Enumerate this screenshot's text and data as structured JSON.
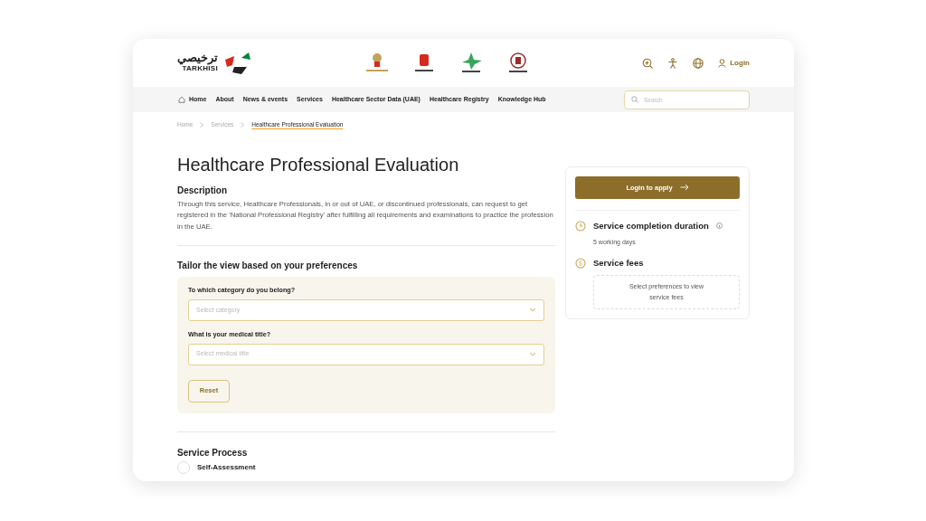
{
  "brand": {
    "arabic_name": "ترخيصي",
    "name": "TARKHISI"
  },
  "partner_logos": [
    {
      "kind": "falcon"
    },
    {
      "kind": "crest"
    },
    {
      "kind": "star"
    },
    {
      "kind": "seal"
    }
  ],
  "header_actions": [
    {
      "kind": "zoom"
    },
    {
      "kind": "accessibility"
    },
    {
      "kind": "language"
    }
  ],
  "login": "Login",
  "nav": {
    "items": [
      {
        "label": "Home",
        "kind": "home"
      },
      {
        "label": "About"
      },
      {
        "label": "News & events"
      },
      {
        "label": "Services"
      },
      {
        "label": "Healthcare Sector Data (UAE)"
      },
      {
        "label": "Healthcare Registry"
      },
      {
        "label": "Knowledge Hub"
      }
    ],
    "search": {
      "placeholder": "Search"
    }
  },
  "breadcrumb": [
    {
      "label": "Home",
      "current": false
    },
    {
      "label": "Services",
      "current": false
    },
    {
      "label": "Healthcare Professional Evaluation",
      "current": true
    }
  ],
  "title": "Healthcare Professional Evaluation",
  "description": {
    "heading": "Description",
    "text": "Through this service, Healthcare Professionals, in or out of UAE, or discontinued professionals, can request to get registered in the 'National Professional Registry' after fulfilling all requirements and examinations to practice the profession in the UAE."
  },
  "preferences": {
    "heading": "Tailor the view based on your preferences",
    "fields": [
      {
        "label": "To which category do you belong?",
        "placeholder": "Select category"
      },
      {
        "label": "What is your medical title?",
        "placeholder": "Select medical title"
      }
    ],
    "reset": "Reset"
  },
  "side_card": {
    "apply_button": "Login to apply",
    "duration": {
      "title": "Service completion duration",
      "value": "5 working days"
    },
    "fees": {
      "title": "Service fees",
      "note": "Select preferences to view service fees"
    }
  },
  "process": {
    "heading": "Service Process",
    "steps": [
      {
        "label": "Self-Assessment"
      }
    ]
  }
}
